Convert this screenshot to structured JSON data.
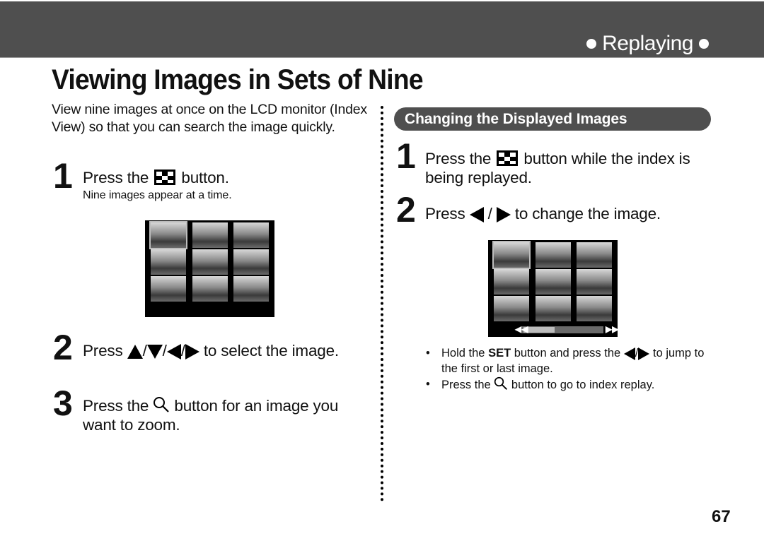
{
  "header": {
    "section_tag": "Replaying"
  },
  "page_title": "Viewing Images in Sets of Nine",
  "left": {
    "intro": "View nine images at once on the LCD monitor (Index View) so that you can search the image quickly.",
    "steps": [
      {
        "num": "1",
        "before": "Press the",
        "after": "button.",
        "icon": "index-button-icon",
        "sub": "Nine images appear at a time."
      },
      {
        "num": "2",
        "before": "Press",
        "separator": "/",
        "after": "to select the image.",
        "icons": [
          "up-arrow-icon",
          "down-arrow-icon",
          "left-arrow-icon",
          "right-arrow-icon"
        ]
      },
      {
        "num": "3",
        "before": "Press the",
        "after": "button for an image you want to zoom.",
        "icon": "magnify-icon"
      }
    ],
    "lcd": {
      "thumbnails": 9,
      "selected_index": 0
    }
  },
  "right": {
    "subheading": "Changing the Displayed Images",
    "steps": [
      {
        "num": "1",
        "before": "Press the",
        "after": "button while the index is being replayed.",
        "icon": "index-button-icon"
      },
      {
        "num": "2",
        "before": "Press",
        "separator": "/",
        "after": "to change the image.",
        "icons": [
          "left-arrow-icon",
          "right-arrow-icon"
        ]
      }
    ],
    "lcd": {
      "thumbnails": 9,
      "selected_index": 0,
      "scroll_position_fraction": 0.4
    },
    "notes": [
      {
        "p1": "Hold the",
        "bold": "SET",
        "p2": "button and press the",
        "sep": "/",
        "p3": "to jump to the first or last image."
      },
      {
        "p1": "Press the",
        "p2": "button to go to index replay."
      }
    ],
    "bullet": "•"
  },
  "page_number": "67"
}
